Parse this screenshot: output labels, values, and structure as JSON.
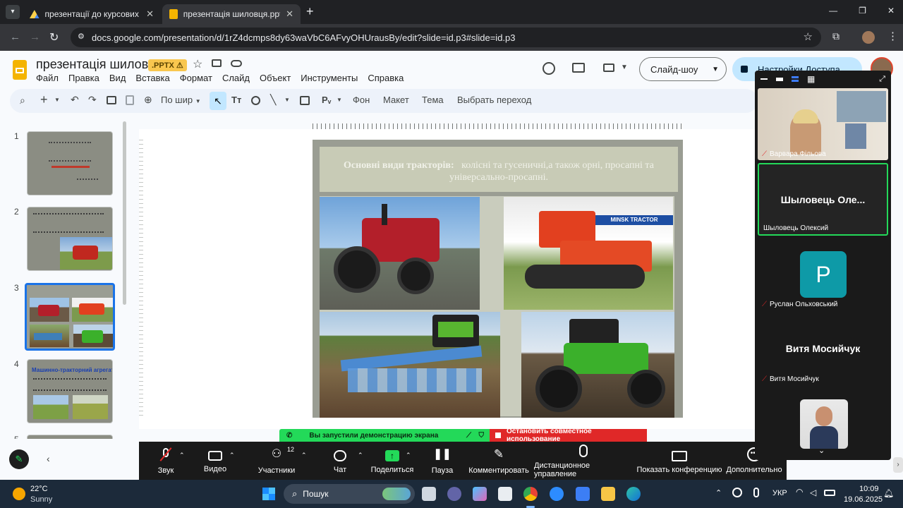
{
  "browser": {
    "tabs": [
      {
        "title": "презентації до курсових груп"
      },
      {
        "title": "презентація шиловця.pptx - G"
      }
    ],
    "url": "docs.google.com/presentation/d/1rZ4dcmps8dy63waVbC6AFvyOHUrausBy/edit?slide=id.p3#slide=id.p3"
  },
  "doc": {
    "title": "презентація шиловця",
    "badge": ".PPTX ⚠",
    "menu": [
      "Файл",
      "Правка",
      "Вид",
      "Вставка",
      "Формат",
      "Слайд",
      "Объект",
      "Инструменты",
      "Справка"
    ],
    "slideshow": "Слайд-шоу",
    "share": "Настройки Доступа"
  },
  "toolbar": {
    "zoom": "По шир",
    "background": "Фон",
    "layout": "Макет",
    "theme": "Тема",
    "transition": "Выбрать переход"
  },
  "thumbnails": [
    {
      "n": "1"
    },
    {
      "n": "2"
    },
    {
      "n": "3"
    },
    {
      "n": "4",
      "text": "Машинно-тракторний агрегат -"
    },
    {
      "n": "5"
    }
  ],
  "slide": {
    "title_bold": "Основні види тракторів:",
    "title_rest": "колісні та гусеничні,а також орні, просапні та універсально-просапні.",
    "brand": "MINSK TRACTOR"
  },
  "share_banner": {
    "left": "Вы запустили демонстрацию экрана",
    "right": "Остановить совместное использование"
  },
  "zoom_controls": [
    {
      "label": "Звук",
      "icon": "mic-muted-icon"
    },
    {
      "label": "Видео",
      "icon": "video-icon"
    },
    {
      "label": "Участники",
      "icon": "participants-icon",
      "count": "12"
    },
    {
      "label": "Чат",
      "icon": "chat-icon"
    },
    {
      "label": "Поделиться",
      "icon": "share-icon"
    },
    {
      "label": "Пауза",
      "icon": "pause-icon"
    },
    {
      "label": "Комментировать",
      "icon": "pen-icon"
    },
    {
      "label": "Дистанционное управление",
      "icon": "mouse-icon"
    },
    {
      "label": "Показать конференцию",
      "icon": "show-icon"
    },
    {
      "label": "Дополнительно",
      "icon": "more-icon"
    }
  ],
  "participants": [
    {
      "name": "Варвара Фільова"
    },
    {
      "name": "Шыловець Олексий",
      "display": "Шыловець  Оле..."
    },
    {
      "name": "Руслан Ольховський",
      "initial": "P"
    },
    {
      "name": "Витя Мосийчук",
      "display": "Витя Мосийчук"
    }
  ],
  "taskbar": {
    "temp": "22°C",
    "weather": "Sunny",
    "search": "Пошук",
    "lang": "УКР",
    "time": "10:09",
    "date": "19.06.2025"
  },
  "colors": {
    "accent": "#1a73e8",
    "zoom_green": "#23d959",
    "stop_red": "#e02828"
  }
}
